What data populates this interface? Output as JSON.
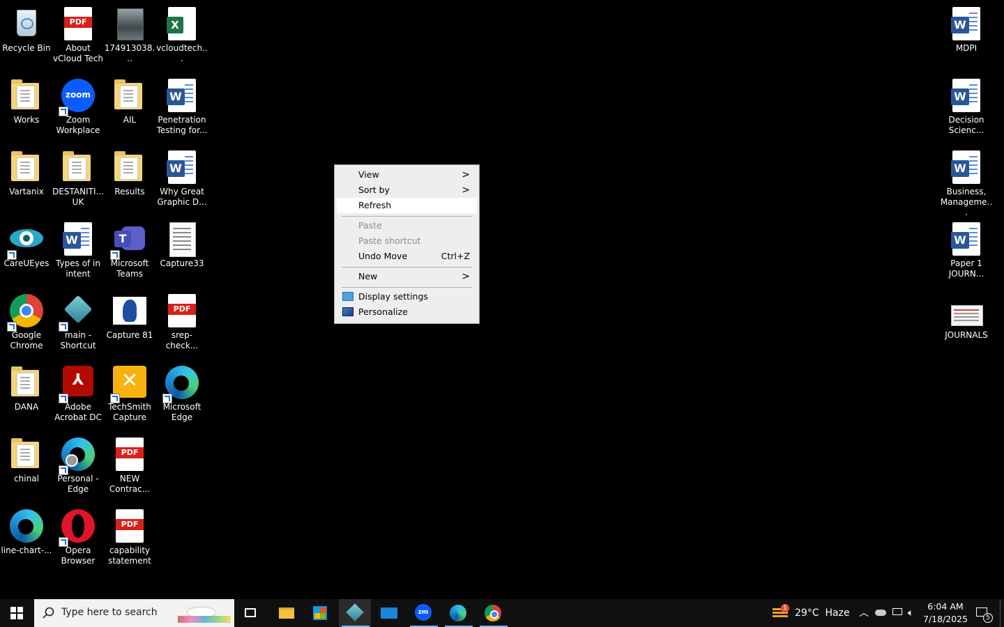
{
  "desktop": {
    "left_icons": [
      {
        "label": "Recycle Bin",
        "icon": "recycle-bin-icon"
      },
      {
        "label": "About vCloud Tech",
        "icon": "pdf-icon"
      },
      {
        "label": "174913038...",
        "icon": "image-icon"
      },
      {
        "label": "vcloudtech...",
        "icon": "excel-icon"
      },
      {
        "label": "Works",
        "icon": "folder-icon"
      },
      {
        "label": "Zoom Workplace",
        "icon": "zoom-icon"
      },
      {
        "label": "AIL",
        "icon": "folder-icon"
      },
      {
        "label": "Penetration Testing for...",
        "icon": "word-icon"
      },
      {
        "label": "Vartanix",
        "icon": "folder-icon"
      },
      {
        "label": "DESTANITI... UK",
        "icon": "folder-icon"
      },
      {
        "label": "Results",
        "icon": "folder-icon"
      },
      {
        "label": "Why Great Graphic D...",
        "icon": "word-icon"
      },
      {
        "label": "CareUEyes",
        "icon": "eye-icon"
      },
      {
        "label": "Types of in intent",
        "icon": "word-icon"
      },
      {
        "label": "Microsoft Teams",
        "icon": "teams-icon"
      },
      {
        "label": "Capture33",
        "icon": "image-icon"
      },
      {
        "label": "Google Chrome",
        "icon": "chrome-icon"
      },
      {
        "label": "main - Shortcut",
        "icon": "app-cube-icon"
      },
      {
        "label": "Capture 81",
        "icon": "image-icon"
      },
      {
        "label": "srep-check...",
        "icon": "pdf-icon"
      },
      {
        "label": "DANA",
        "icon": "folder-icon"
      },
      {
        "label": "Adobe Acrobat DC",
        "icon": "acrobat-icon"
      },
      {
        "label": "TechSmith Capture",
        "icon": "techsmith-icon"
      },
      {
        "label": "Microsoft Edge",
        "icon": "edge-icon"
      },
      {
        "label": "chinal",
        "icon": "folder-icon"
      },
      {
        "label": "Personal - Edge",
        "icon": "edge-icon"
      },
      {
        "label": "NEW Contrac...",
        "icon": "pdf-icon"
      },
      {
        "label": "line-chart-...",
        "icon": "edge-icon"
      },
      {
        "label": "Opera Browser",
        "icon": "opera-icon"
      },
      {
        "label": "capability statement",
        "icon": "pdf-icon"
      }
    ],
    "right_icons": [
      {
        "label": "MDPI",
        "icon": "word-icon"
      },
      {
        "label": "Decision Scienc...",
        "icon": "word-icon"
      },
      {
        "label": "Business, Manageme...",
        "icon": "word-icon"
      },
      {
        "label": "Paper 1 JOURN...",
        "icon": "word-icon"
      },
      {
        "label": "JOURNALS",
        "icon": "image-icon"
      }
    ]
  },
  "context_menu": {
    "view": "View",
    "sort_by": "Sort by",
    "refresh": "Refresh",
    "paste": "Paste",
    "paste_shortcut": "Paste shortcut",
    "undo_move": "Undo Move",
    "undo_move_shortcut": "Ctrl+Z",
    "new": "New",
    "display_settings": "Display settings",
    "personalize": "Personalize",
    "submenu_arrow": ">"
  },
  "taskbar": {
    "search_placeholder": "Type here to search",
    "weather": "29°C  Haze",
    "weather_badge": "1",
    "time": "6:04 AM",
    "date": "7/18/2025",
    "notification_count": "5",
    "pinned": [
      "task-view-icon",
      "file-explorer-icon",
      "store-icon",
      "app-cube-icon",
      "mail-icon",
      "zoom-icon",
      "edge-icon",
      "chrome-icon"
    ]
  },
  "colors": {
    "desktop_bg": "#000000",
    "menu_bg": "#eeeeee",
    "taskbar_bg": "#101010",
    "accent_underline": "#76b9ed"
  }
}
